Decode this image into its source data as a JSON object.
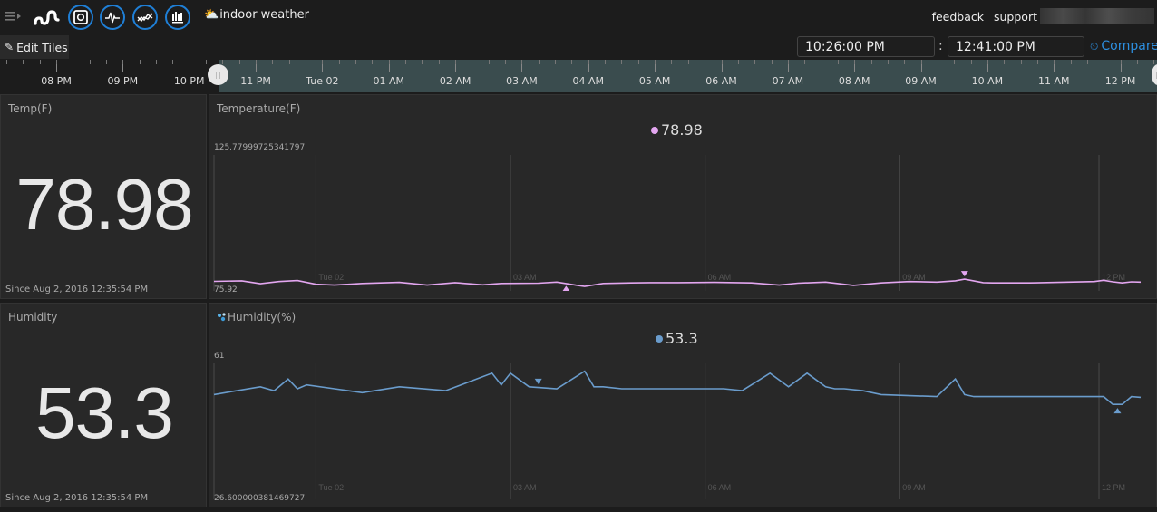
{
  "header": {
    "menu_icon": "hamburger-menu-icon",
    "logo_icon": "wave-logo-icon",
    "app_buttons": [
      {
        "name": "safe-app-icon"
      },
      {
        "name": "pulse-app-icon"
      },
      {
        "name": "trend-app-icon"
      },
      {
        "name": "bars-app-icon"
      }
    ],
    "dashboard_icon": "⛅",
    "dashboard_title": "indoor weather",
    "links": {
      "feedback": "feedback",
      "support": "support"
    }
  },
  "toolbar": {
    "edit_tiles_label": "Edit Tiles",
    "start_time": "10:26:00 PM",
    "separator": ":",
    "end_time": "12:41:00 PM",
    "compare_label": "Compare"
  },
  "timeline": {
    "labels": [
      "08 PM",
      "09 PM",
      "10 PM",
      "11 PM",
      "Tue 02",
      "01 AM",
      "02 AM",
      "03 AM",
      "04 AM",
      "05 AM",
      "06 AM",
      "07 AM",
      "08 AM",
      "09 AM",
      "10 AM",
      "11 AM",
      "12 PM"
    ]
  },
  "tiles": {
    "temp_value": {
      "title": "Temp(F)",
      "value": "78.98",
      "since": "Since Aug 2, 2016 12:35:54 PM"
    },
    "humidity_value": {
      "title": "Humidity",
      "value": "53.3",
      "since": "Since Aug 2, 2016 12:35:54 PM"
    },
    "temp_chart": {
      "title": "Temperature(F)",
      "current": "78.98",
      "ymax": "125.77999725341797",
      "ymin": "75.92",
      "color": "#e3a6f0"
    },
    "humidity_chart": {
      "title": "Humidity(%)",
      "icon": "water-drops-icon",
      "current": "53.3",
      "ymax": "61",
      "ymin": "26.600000381469727",
      "color": "#6a9ccc"
    }
  },
  "chart_data": [
    {
      "type": "line",
      "title": "Temperature(F)",
      "ylim": [
        75.92,
        125.78
      ],
      "x_tick_labels": [
        "Tue 02",
        "03 AM",
        "06 AM",
        "09 AM",
        "12 PM"
      ],
      "series": [
        {
          "name": "Temperature(F)",
          "color": "#e3a6f0",
          "x": [
            0,
            0.03,
            0.05,
            0.07,
            0.09,
            0.11,
            0.13,
            0.16,
            0.2,
            0.23,
            0.26,
            0.29,
            0.31,
            0.35,
            0.37,
            0.39,
            0.4,
            0.42,
            0.45,
            0.47,
            0.5,
            0.54,
            0.58,
            0.61,
            0.63,
            0.66,
            0.69,
            0.72,
            0.75,
            0.78,
            0.8,
            0.81,
            0.83,
            0.84,
            0.86,
            0.88,
            0.95,
            0.96,
            0.97,
            0.98,
            0.99,
            1
          ],
          "values": [
            78.8,
            79.0,
            77.9,
            78.7,
            79.1,
            77.7,
            77.4,
            78.0,
            78.4,
            77.4,
            78.3,
            77.5,
            78.0,
            78.1,
            78.5,
            77.4,
            76.9,
            78.0,
            78.2,
            78.3,
            78.3,
            78.4,
            78.2,
            77.4,
            78.1,
            78.5,
            77.3,
            78.2,
            78.7,
            78.5,
            79.0,
            79.6,
            78.3,
            78.2,
            78.2,
            78.2,
            78.7,
            79.2,
            78.6,
            78.2,
            78.6,
            78.5
          ]
        }
      ],
      "markers": [
        {
          "type": "min",
          "x": 0.38
        },
        {
          "type": "max",
          "x": 0.81
        }
      ]
    },
    {
      "type": "line",
      "title": "Humidity(%)",
      "ylim": [
        26.6,
        61
      ],
      "x_tick_labels": [
        "Tue 02",
        "03 AM",
        "06 AM",
        "09 AM",
        "12 PM"
      ],
      "series": [
        {
          "name": "Humidity(%)",
          "color": "#6a9ccc",
          "x": [
            0,
            0.05,
            0.065,
            0.08,
            0.09,
            0.1,
            0.13,
            0.16,
            0.2,
            0.25,
            0.3,
            0.31,
            0.32,
            0.34,
            0.37,
            0.4,
            0.41,
            0.42,
            0.44,
            0.5,
            0.55,
            0.57,
            0.6,
            0.62,
            0.64,
            0.66,
            0.67,
            0.68,
            0.7,
            0.72,
            0.78,
            0.8,
            0.81,
            0.82,
            0.83,
            0.85,
            0.9,
            0.96,
            0.97,
            0.98,
            0.99,
            1
          ],
          "values": [
            53.0,
            55.0,
            54.0,
            57.0,
            54.5,
            55.5,
            54.5,
            53.5,
            55.0,
            54.0,
            58.5,
            55.5,
            58.5,
            55.0,
            54.5,
            59.0,
            55.0,
            55.0,
            54.5,
            54.5,
            54.5,
            54.0,
            58.5,
            55.0,
            58.5,
            55.0,
            54.5,
            54.5,
            54.0,
            53.0,
            52.5,
            57.0,
            53.0,
            52.5,
            52.5,
            52.5,
            52.5,
            52.5,
            50.5,
            50.5,
            52.5,
            52.3
          ]
        }
      ],
      "markers": [
        {
          "type": "max",
          "x": 0.35
        },
        {
          "type": "min",
          "x": 0.975
        }
      ]
    }
  ]
}
